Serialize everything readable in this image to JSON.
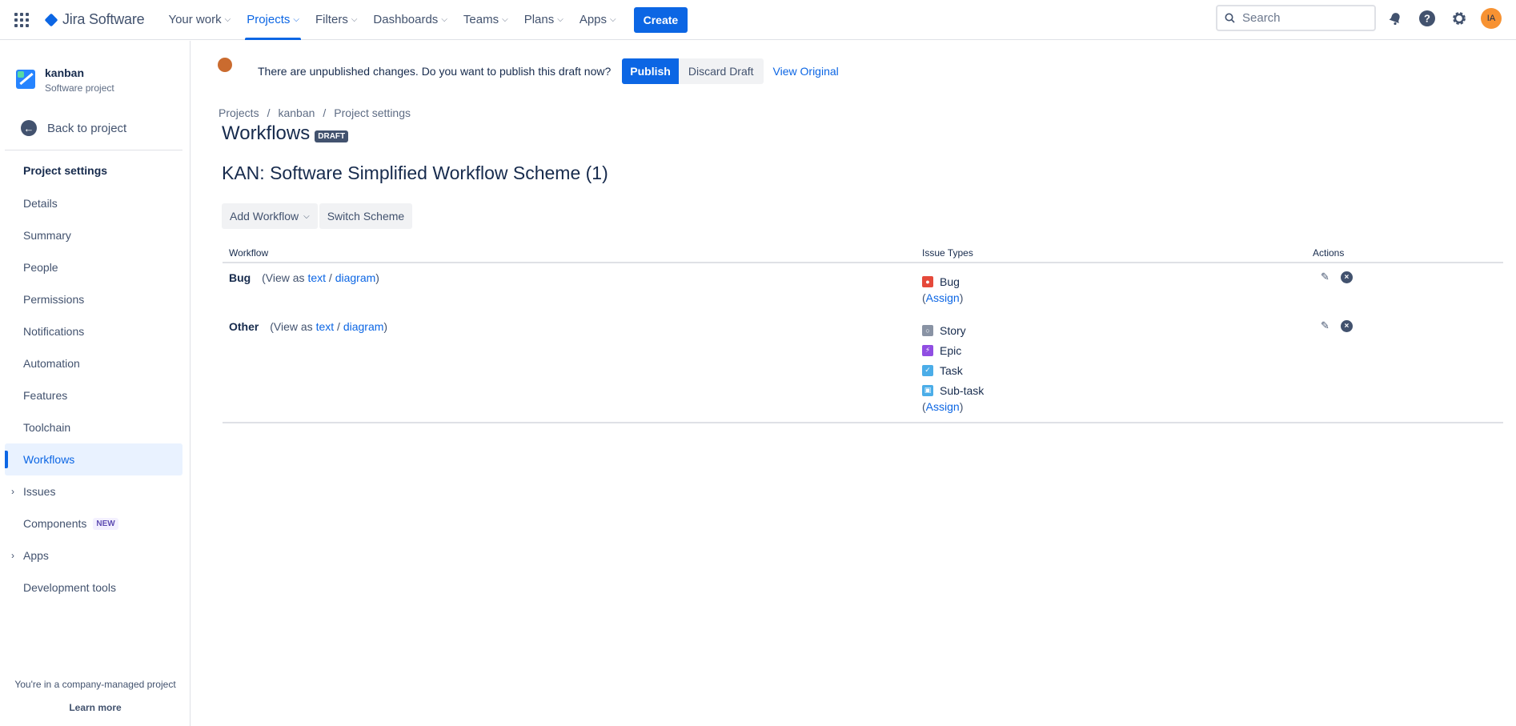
{
  "topnav": {
    "logo": "Jira Software",
    "items": [
      {
        "label": "Your work"
      },
      {
        "label": "Projects"
      },
      {
        "label": "Filters"
      },
      {
        "label": "Dashboards"
      },
      {
        "label": "Teams"
      },
      {
        "label": "Plans"
      },
      {
        "label": "Apps"
      }
    ],
    "active": "Projects",
    "create_label": "Create",
    "search_placeholder": "Search",
    "avatar_initials": "IA",
    "accent": "#0c66e4"
  },
  "sidebar": {
    "project_name": "kanban",
    "project_type": "Software project",
    "back_label": "Back to project",
    "heading": "Project settings",
    "items": [
      {
        "label": "Details"
      },
      {
        "label": "Summary"
      },
      {
        "label": "People"
      },
      {
        "label": "Permissions"
      },
      {
        "label": "Notifications"
      },
      {
        "label": "Automation"
      },
      {
        "label": "Features"
      },
      {
        "label": "Toolchain"
      },
      {
        "label": "Workflows"
      },
      {
        "label": "Issues"
      },
      {
        "label": "Components",
        "badge": "NEW"
      },
      {
        "label": "Apps"
      },
      {
        "label": "Development tools"
      }
    ],
    "active": "Workflows",
    "footer_text": "You're in a company-managed project",
    "footer_link": "Learn more"
  },
  "draftbar": {
    "message": "There are unpublished changes. Do you want to publish this draft now?",
    "publish_label": "Publish",
    "discard_label": "Discard Draft",
    "view_original_label": "View Original"
  },
  "breadcrumbs": [
    "Projects",
    "kanban",
    "Project settings"
  ],
  "page": {
    "title": "Workflows",
    "badge": "DRAFT",
    "scheme_title": "KAN: Software Simplified Workflow Scheme (1)",
    "add_workflow_label": "Add Workflow",
    "switch_scheme_label": "Switch Scheme"
  },
  "table": {
    "headers": {
      "workflow": "Workflow",
      "issue_types": "Issue Types",
      "actions": "Actions"
    },
    "view_as": "(View as",
    "text_link": "text",
    "slash": "/",
    "diagram_link": "diagram",
    "close_paren": ")",
    "assign_label": "Assign",
    "rows": [
      {
        "name": "Bug",
        "issue_types": [
          {
            "label": "Bug",
            "icon": "bug-icon",
            "color": "#e5493a"
          }
        ]
      },
      {
        "name": "Other",
        "issue_types": [
          {
            "label": "Story",
            "icon": "story-icon",
            "color": "#8993a4"
          },
          {
            "label": "Epic",
            "icon": "epic-icon",
            "color": "#904ee2"
          },
          {
            "label": "Task",
            "icon": "task-icon",
            "color": "#4bade8"
          },
          {
            "label": "Sub-task",
            "icon": "subtask-icon",
            "color": "#4bade8"
          }
        ]
      }
    ]
  }
}
